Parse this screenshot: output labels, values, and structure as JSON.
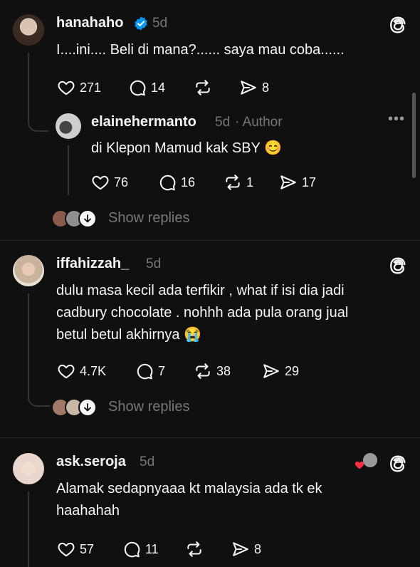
{
  "post1": {
    "username": "hanahaho",
    "verified": true,
    "time": "5d",
    "text": "I....ini.... Beli di mana?...... saya mau coba......",
    "likes": "271",
    "comments": "14",
    "reposts": "",
    "shares": "8"
  },
  "reply1": {
    "username": "elainehermanto",
    "time": "5d",
    "badge": "· Author",
    "text": "di Klepon Mamud kak SBY 😊",
    "likes": "76",
    "comments": "16",
    "reposts": "1",
    "shares": "17"
  },
  "show_replies_1": "Show replies",
  "post2": {
    "username": "iffahizzah_",
    "time": "5d",
    "lines": [
      "dulu masa kecil ada terfikir , what if isi dia jadi",
      "cadbury chocolate . nohhh ada pula orang jual",
      "betul betul akhirnya 😭"
    ],
    "likes": "4.7K",
    "comments": "7",
    "reposts": "38",
    "shares": "29"
  },
  "show_replies_2": "Show replies",
  "post3": {
    "username": "ask.seroja",
    "time": "5d",
    "lines": [
      "Alamak sedapnyaaa kt malaysia ada tk ek",
      "haahahah"
    ],
    "likes": "57",
    "comments": "11",
    "reposts": "",
    "shares": "8"
  },
  "icons": [
    "threads-logo-icon",
    "heart-icon",
    "comment-icon",
    "repost-icon",
    "share-icon",
    "verified-badge-icon",
    "more-icon",
    "arrow-down-icon"
  ],
  "colors": {
    "background": "#101010",
    "text": "#f3f5f7",
    "muted": "#777777",
    "verified": "#0095f6",
    "like_red": "#ff3040"
  }
}
